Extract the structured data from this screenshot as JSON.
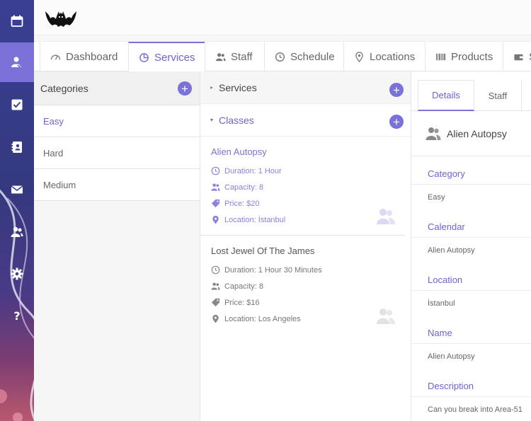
{
  "colors": {
    "accent": "#7a72d8",
    "sidebar": "#3a3f93"
  },
  "sidebar": {
    "items": [
      {
        "icon": "calendar-icon"
      },
      {
        "icon": "user-check-icon",
        "active": true
      },
      {
        "icon": "checkbox-icon"
      },
      {
        "icon": "address-book-icon"
      },
      {
        "icon": "envelope-icon"
      },
      {
        "icon": "users-icon"
      },
      {
        "icon": "gear-icon"
      },
      {
        "icon": "question-icon"
      }
    ]
  },
  "tabs": [
    {
      "label": "Dashboard",
      "icon": "gauge-icon"
    },
    {
      "label": "Services",
      "icon": "pie-icon",
      "active": true
    },
    {
      "label": "Staff",
      "icon": "users-icon"
    },
    {
      "label": "Schedule",
      "icon": "clock-icon"
    },
    {
      "label": "Locations",
      "icon": "pin-icon"
    },
    {
      "label": "Products",
      "icon": "barcode-icon"
    },
    {
      "label": "S",
      "icon": "wallet-icon"
    }
  ],
  "categories": {
    "title": "Categories",
    "items": [
      {
        "label": "Easy",
        "active": true
      },
      {
        "label": "Hard"
      },
      {
        "label": "Medium"
      }
    ]
  },
  "services": {
    "groups": [
      {
        "label": "Services",
        "caret": "▸"
      },
      {
        "label": "Classes",
        "caret": "▾"
      }
    ],
    "items": [
      {
        "title": "Alien Autopsy",
        "duration": "Duration: 1 Hour",
        "capacity": "Capacity: 8",
        "price": "Price: $20",
        "location": "Location: İstanbul",
        "active": true
      },
      {
        "title": "Lost Jewel Of The James",
        "duration": "Duration: 1 Hour 30 Minutes",
        "capacity": "Capacity: 8",
        "price": "Price: $16",
        "location": "Location: Los Angeles"
      }
    ]
  },
  "details": {
    "tabs": [
      {
        "label": "Details",
        "active": true
      },
      {
        "label": "Staff"
      }
    ],
    "name": "Alien Autopsy",
    "fields": [
      {
        "label": "Category",
        "value": "Easy"
      },
      {
        "label": "Calendar",
        "value": "Alien Autopsy"
      },
      {
        "label": "Location",
        "value": "İstanbul"
      },
      {
        "label": "Name",
        "value": "Alien Autopsy"
      },
      {
        "label": "Description",
        "value": "Can you break into Area-51"
      }
    ]
  }
}
